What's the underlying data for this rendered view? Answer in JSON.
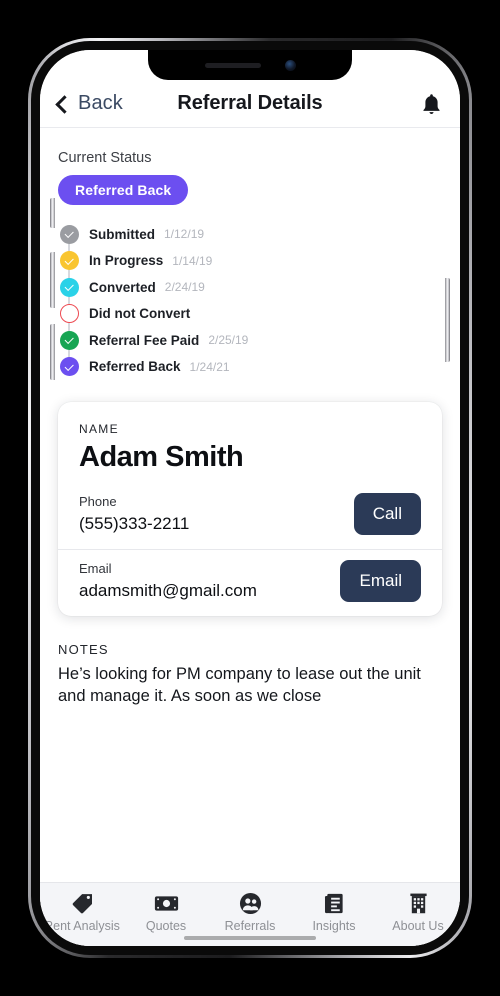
{
  "device": {
    "notch": {
      "speaker": "speaker-grille",
      "camera": "front-camera"
    },
    "buttons": [
      "mute-switch",
      "volume-up",
      "volume-down",
      "power"
    ]
  },
  "navbar": {
    "back_label": "Back",
    "title": "Referral Details",
    "bell_icon": "bell-icon"
  },
  "status": {
    "section_label": "Current Status",
    "badge_label": "Referred Back",
    "badge_color": "#6C4FF0"
  },
  "timeline": [
    {
      "label": "Submitted",
      "date": "1/12/19",
      "color": "#9a9ca1",
      "state": "done"
    },
    {
      "label": "In Progress",
      "date": "1/14/19",
      "color": "#f9c530",
      "state": "done"
    },
    {
      "label": "Converted",
      "date": "2/24/19",
      "color": "#2ad2e8",
      "state": "done"
    },
    {
      "label": "Did not Convert",
      "date": "",
      "color": "#ed4a52",
      "state": "empty"
    },
    {
      "label": "Referral Fee Paid",
      "date": "2/25/19",
      "color": "#17a553",
      "state": "done"
    },
    {
      "label": "Referred Back",
      "date": "1/24/21",
      "color": "#6c4ff0",
      "state": "done"
    }
  ],
  "contact": {
    "name_caption": "NAME",
    "name": "Adam Smith",
    "phone_caption": "Phone",
    "phone": "(555)333-2211",
    "call_label": "Call",
    "email_caption": "Email",
    "email": "adamsmith@gmail.com",
    "email_label": "Email",
    "button_color": "#2B3A57"
  },
  "notes": {
    "caption": "NOTES",
    "body": "He’s looking for PM company to lease out the unit and manage it. As soon as we close"
  },
  "tabs": [
    {
      "label": "Rent Analysis",
      "icon": "tag-icon"
    },
    {
      "label": "Quotes",
      "icon": "banknote-icon"
    },
    {
      "label": "Referrals",
      "icon": "people-circle-icon"
    },
    {
      "label": "Insights",
      "icon": "document-icon"
    },
    {
      "label": "About Us",
      "icon": "building-icon"
    }
  ]
}
